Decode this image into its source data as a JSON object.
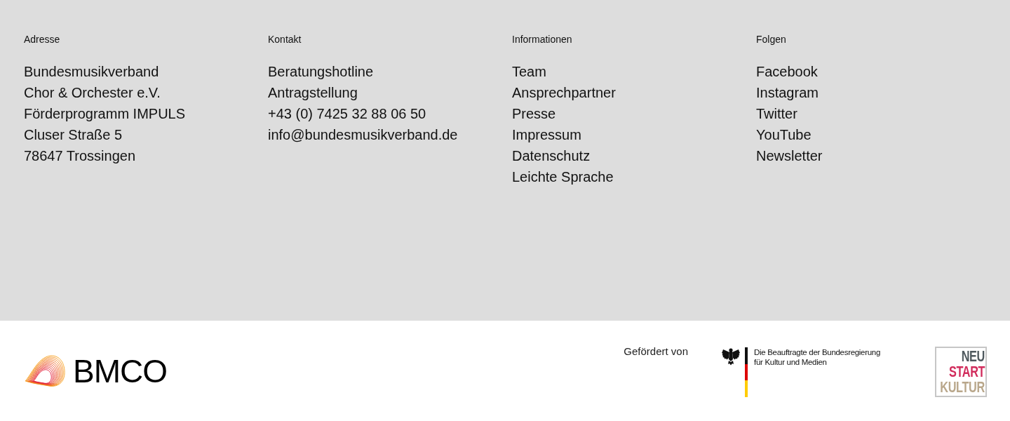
{
  "columns": [
    {
      "heading": "Adresse",
      "items": [
        "Bundesmusikverband",
        "Chor & Orchester e.V.",
        "Förderprogramm IMPULS",
        "Cluser Straße 5",
        "78647 Trossingen"
      ]
    },
    {
      "heading": "Kontakt",
      "items": [
        "Beratungshotline",
        "Antragstellung",
        "+43 (0) 7425 32 88 06 50",
        "info@bundesmusikverband.de"
      ]
    },
    {
      "heading": "Informationen",
      "items": [
        "Team",
        "Ansprechpartner",
        "Presse",
        "Impressum",
        "Datenschutz",
        "Leichte Sprache"
      ]
    },
    {
      "heading": "Folgen",
      "items": [
        "Facebook",
        "Instagram",
        "Twitter",
        "YouTube",
        "Newsletter"
      ]
    }
  ],
  "brand": {
    "logo_text": "BMCO"
  },
  "funding": {
    "label": "Gefördert von",
    "agency_lines": [
      "Die Beauftragte der Bundesregierung",
      "für Kultur und Medien"
    ],
    "program_logo": [
      {
        "text": "NEU",
        "color": "#4f595e"
      },
      {
        "text": "START",
        "color": "#d12c5c"
      },
      {
        "text": "KULTUR",
        "color": "#b9a78b"
      }
    ]
  }
}
